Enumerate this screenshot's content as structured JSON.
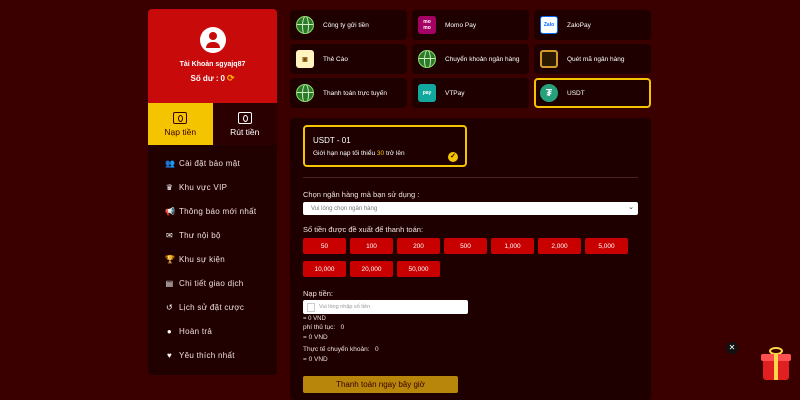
{
  "account": {
    "name": "Tài Khoản sgyajq87",
    "balance_label": "Số dư :",
    "balance_value": "0",
    "refresh_icon": "refresh-icon"
  },
  "tabs": [
    {
      "label": "Nạp tiền",
      "icon": "deposit-icon",
      "active": true
    },
    {
      "label": "Rút tiền",
      "icon": "withdraw-icon",
      "active": false
    }
  ],
  "menu": [
    {
      "label": "Cài đặt bảo mật",
      "icon": "users-gear-icon"
    },
    {
      "label": "Khu vực VIP",
      "icon": "crown-icon"
    },
    {
      "label": "Thông báo mới nhất",
      "icon": "megaphone-icon"
    },
    {
      "label": "Thư nội bộ",
      "icon": "envelope-icon"
    },
    {
      "label": "Khu sự kiện",
      "icon": "trophy-icon"
    },
    {
      "label": "Chi tiết giao dịch",
      "icon": "document-icon"
    },
    {
      "label": "Lịch sử đặt cược",
      "icon": "history-icon"
    },
    {
      "label": "Hoàn trả",
      "icon": "coin-icon"
    },
    {
      "label": "Yêu thích nhất",
      "icon": "heart-icon"
    }
  ],
  "payment_methods": [
    {
      "label": "Công ty gửi tiền",
      "icon": "globe-icon"
    },
    {
      "label": "Momo Pay",
      "icon": "momo-icon",
      "icon_text": "mo\nmo"
    },
    {
      "label": "ZaloPay",
      "icon": "zalopay-icon",
      "icon_text": "Zalo"
    },
    {
      "label": "Thẻ Cào",
      "icon": "card-icon",
      "icon_text": "▣"
    },
    {
      "label": "Chuyển khoản ngân hàng",
      "icon": "globe-icon"
    },
    {
      "label": "Quét mã ngân hàng",
      "icon": "qr-icon"
    },
    {
      "label": "Thanh toán trực tuyến",
      "icon": "globe-icon"
    },
    {
      "label": "VTPay",
      "icon": "vtpay-icon",
      "icon_text": "pay"
    },
    {
      "label": "USDT",
      "icon": "usdt-icon",
      "icon_text": "₮",
      "selected": true
    }
  ],
  "usdt_card": {
    "title": "USDT - 01",
    "limit_prefix": "Giới hạn nạp tối thiểu",
    "limit_value": "30",
    "limit_suffix": "trở lên"
  },
  "bank_select": {
    "label": "Chọn ngân hàng mà bạn sử dụng :",
    "placeholder": "Vui lòng chọn ngân hàng"
  },
  "suggested": {
    "label": "Số tiền được đề xuất để thanh toán:",
    "amounts": [
      "50",
      "100",
      "200",
      "500",
      "1,000",
      "2,000",
      "5,000",
      "10,000",
      "20,000",
      "50,000"
    ]
  },
  "deposit": {
    "label": "Nạp tiền:",
    "placeholder": "Vui lòng nhập số tiền",
    "converted": "= 0 VND",
    "fee_label": "phí thủ tục:",
    "fee_value": "0",
    "fee_converted": "= 0 VND",
    "actual_label": "Thực tế chuyển khoản:",
    "actual_value": "0",
    "actual_converted": "= 0 VND"
  },
  "pay_button": "Thanh toán ngay bây giờ",
  "colors": {
    "background": "#3a0000",
    "accent_red": "#c80a0a",
    "accent_yellow": "#f5c400",
    "panel": "#1e0000"
  }
}
